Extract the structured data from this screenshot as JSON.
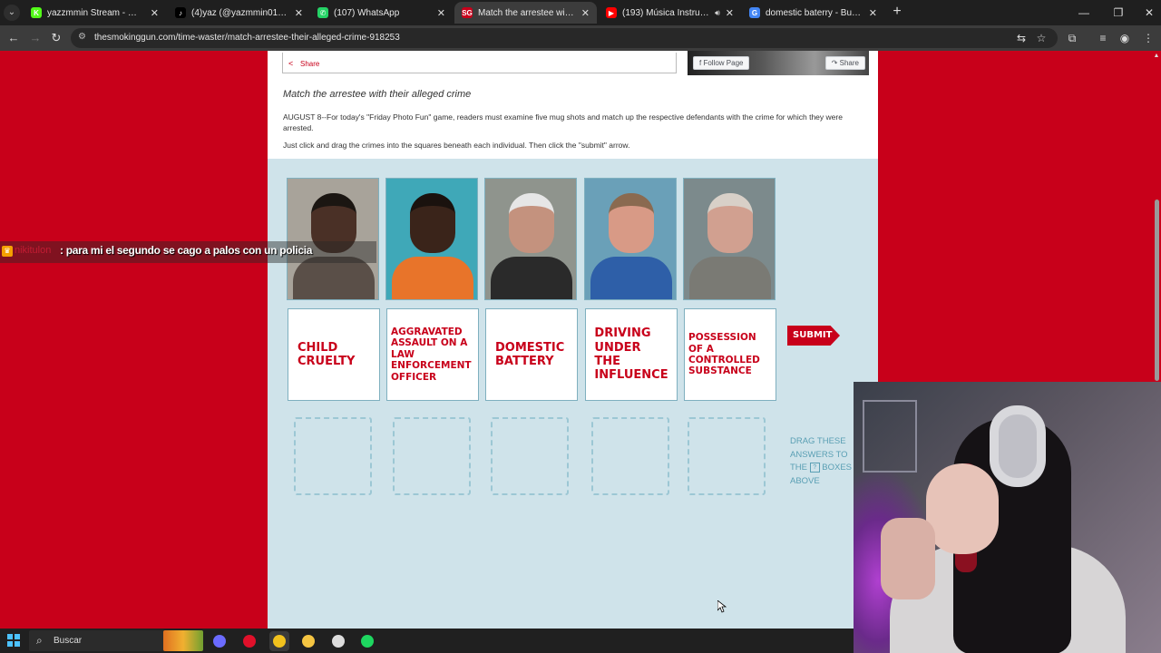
{
  "browser": {
    "tabs": [
      {
        "title": "yazzmmin Stream - Watch Live o",
        "icon": "kick-icon",
        "color": "#53fc18",
        "glyph": "K"
      },
      {
        "title": "(4)yaz (@yazmmin01) | TikTok",
        "icon": "tiktok-icon",
        "color": "#000000",
        "glyph": "♪"
      },
      {
        "title": "(107) WhatsApp",
        "icon": "whatsapp-icon",
        "color": "#25d366",
        "glyph": "✆"
      },
      {
        "title": "Match the arrestee with their al",
        "icon": "smokinggun-icon",
        "color": "#c8001a",
        "glyph": "SG"
      },
      {
        "title": "(193) Música Instrumental c",
        "icon": "youtube-icon",
        "color": "#ff0000",
        "glyph": "▶"
      },
      {
        "title": "domestic baterry - Buscar con G",
        "icon": "google-icon",
        "color": "#4285f4",
        "glyph": "G"
      }
    ],
    "active_tab": 3,
    "url": "thesmokinggun.com/time-waster/match-arrestee-their-alleged-crime-918253"
  },
  "article": {
    "share_label": "Share",
    "follow_label": "Follow Page",
    "fb_share_label": "Share",
    "title": "Match the arrestee with their alleged crime",
    "paragraph1": "AUGUST 8--For today's \"Friday Photo Fun\" game, readers must examine five mug shots and match up the respective defendants with the crime for which they were arrested.",
    "paragraph2": "Just click and drag the crimes into the squares beneath each individual. Then click the \"submit\" arrow."
  },
  "game": {
    "mugshots": [
      {
        "bg": "#a8a39a",
        "skin": "#4a3026",
        "shirt": "#5a4f48",
        "hair": "#1b1612"
      },
      {
        "bg": "#3fa8b8",
        "skin": "#3a241a",
        "shirt": "#e8742a",
        "hair": "#1a120e"
      },
      {
        "bg": "#8f948d",
        "skin": "#c4927e",
        "shirt": "#2a2a2a",
        "hair": "#e6e6e6"
      },
      {
        "bg": "#6aa0b8",
        "skin": "#d89a86",
        "shirt": "#2e5fa8",
        "hair": "#8a6a50"
      },
      {
        "bg": "#7c8a8c",
        "skin": "#d1a090",
        "shirt": "#7a7a74",
        "hair": "#d8d0c8"
      }
    ],
    "crimes": [
      "CHILD CRUELTY",
      "AGGRAVATED ASSAULT ON A LAW ENFORCEMENT OFFICER",
      "DOMESTIC BATTERY",
      "DRIVING UNDER THE INFLUENCE",
      "POSSESSION OF A CONTROLLED SUBSTANCE"
    ],
    "submit_label": "SUBMIT",
    "hint_before": "DRAG THESE ANSWERS TO THE",
    "hint_glyph": "?",
    "hint_after": "BOXES ABOVE"
  },
  "chat": {
    "username": "nikitulon",
    "message": ": para mi el segundo se cago a palos con un policia"
  },
  "taskbar": {
    "search_label": "Buscar",
    "apps": [
      {
        "name": "copilot-icon",
        "color": "#6b6bff"
      },
      {
        "name": "opera-icon",
        "color": "#e0102a"
      },
      {
        "name": "chrome-icon",
        "color": "#f2c21d"
      },
      {
        "name": "file-explorer-icon",
        "color": "#f5c542"
      },
      {
        "name": "obs-icon",
        "color": "#dddddd"
      },
      {
        "name": "spotify-icon",
        "color": "#1ed760"
      }
    ]
  },
  "colors": {
    "accent": "#c8001a",
    "game_bg": "#cfe3ea",
    "hint_text": "#5a9fb4"
  }
}
